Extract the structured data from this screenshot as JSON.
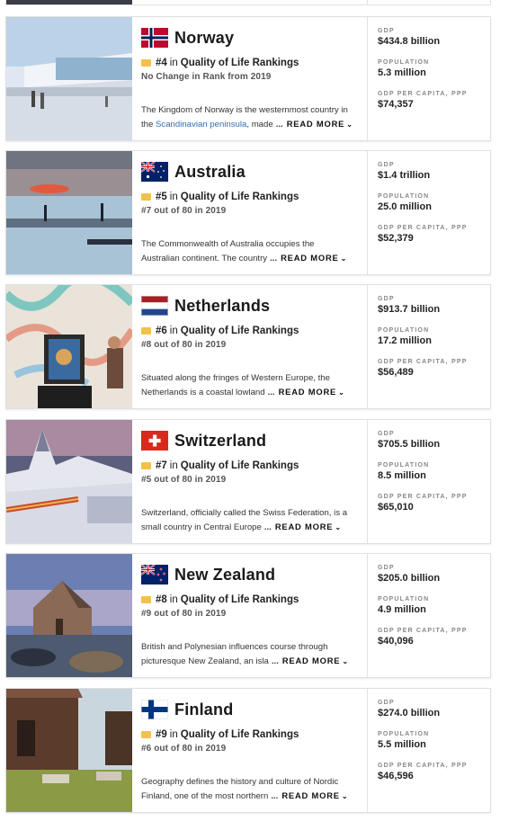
{
  "cards": [
    {
      "country": "Norway",
      "rank": "#4",
      "in": "in",
      "list": "Quality of Life Rankings",
      "prev": "No Change in Rank from 2019",
      "desc1": "The Kingdom of Norway is the westernmost country in",
      "desc2a": "the ",
      "desc2link": "Scandinavian peninsula",
      "desc2b": ", made",
      "stats": {
        "gdp_label": "GDP",
        "gdp": "$434.8 billion",
        "pop_label": "POPULATION",
        "pop": "5.3 million",
        "pc_label": "GDP PER CAPITA, PPP",
        "pc": "$74,357"
      }
    },
    {
      "country": "Australia",
      "rank": "#5",
      "in": "in",
      "list": "Quality of Life Rankings",
      "prev": "#7 out of 80 in 2019",
      "desc1": "The Commonwealth of Australia occupies the",
      "desc2a": "Australian continent. The country",
      "desc2link": "",
      "desc2b": "",
      "stats": {
        "gdp_label": "GDP",
        "gdp": "$1.4 trillion",
        "pop_label": "POPULATION",
        "pop": "25.0 million",
        "pc_label": "GDP PER CAPITA, PPP",
        "pc": "$52,379"
      }
    },
    {
      "country": "Netherlands",
      "rank": "#6",
      "in": "in",
      "list": "Quality of Life Rankings",
      "prev": "#8 out of 80 in 2019",
      "desc1": "Situated along the fringes of Western Europe, the",
      "desc2a": "Netherlands is a coastal lowland",
      "desc2link": "",
      "desc2b": "",
      "stats": {
        "gdp_label": "GDP",
        "gdp": "$913.7 billion",
        "pop_label": "POPULATION",
        "pop": "17.2 million",
        "pc_label": "GDP PER CAPITA, PPP",
        "pc": "$56,489"
      }
    },
    {
      "country": "Switzerland",
      "rank": "#7",
      "in": "in",
      "list": "Quality of Life Rankings",
      "prev": "#5 out of 80 in 2019",
      "desc1": "Switzerland, officially called the Swiss Federation, is a",
      "desc2a": "small country in Central Europe",
      "desc2link": "",
      "desc2b": "",
      "stats": {
        "gdp_label": "GDP",
        "gdp": "$705.5 billion",
        "pop_label": "POPULATION",
        "pop": "8.5 million",
        "pc_label": "GDP PER CAPITA, PPP",
        "pc": "$65,010"
      }
    },
    {
      "country": "New Zealand",
      "rank": "#8",
      "in": "in",
      "list": "Quality of Life Rankings",
      "prev": "#9 out of 80 in 2019",
      "desc1": "British and Polynesian influences course through",
      "desc2a": "picturesque New Zealand, an isla",
      "desc2link": "",
      "desc2b": "",
      "stats": {
        "gdp_label": "GDP",
        "gdp": "$205.0 billion",
        "pop_label": "POPULATION",
        "pop": "4.9 million",
        "pc_label": "GDP PER CAPITA, PPP",
        "pc": "$40,096"
      }
    },
    {
      "country": "Finland",
      "rank": "#9",
      "in": "in",
      "list": "Quality of Life Rankings",
      "prev": "#6 out of 80 in 2019",
      "desc1": "Geography defines the history and culture of Nordic",
      "desc2a": "Finland, one of the most northern",
      "desc2link": "",
      "desc2b": "",
      "stats": {
        "gdp_label": "GDP",
        "gdp": "$274.0 billion",
        "pop_label": "POPULATION",
        "pop": "5.5 million",
        "pc_label": "GDP PER CAPITA, PPP",
        "pc": "$46,596"
      }
    }
  ],
  "ui": {
    "ellipsis": "...",
    "read_more": "READ MORE",
    "chevron": "⌄"
  },
  "colors": {
    "rank_badge": "#f3c14a",
    "link": "#2f6fb5",
    "divider": "#e2e2e2"
  }
}
